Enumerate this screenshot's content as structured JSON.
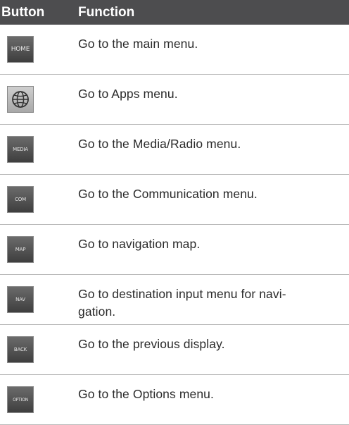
{
  "header": {
    "button_col": "Button",
    "function_col": "Function"
  },
  "rows": [
    {
      "button_label": "HOME",
      "function": "Go to the main menu."
    },
    {
      "button_label": "",
      "icon": "globe-icon",
      "function": "Go to Apps menu."
    },
    {
      "button_label": "MEDIA",
      "function": "Go to the Media/Radio menu."
    },
    {
      "button_label": "COM",
      "function": "Go to the Communication menu."
    },
    {
      "button_label": "MAP",
      "function": "Go to navigation map."
    },
    {
      "button_label": "NAV",
      "function": "Go to destination input menu for navigation.",
      "function_lines": [
        "Go to destination input menu for navi-",
        "gation."
      ]
    },
    {
      "button_label": "BACK",
      "function": "Go to the previous display."
    },
    {
      "button_label": "OPTION",
      "function": "Go to the Options menu."
    }
  ]
}
